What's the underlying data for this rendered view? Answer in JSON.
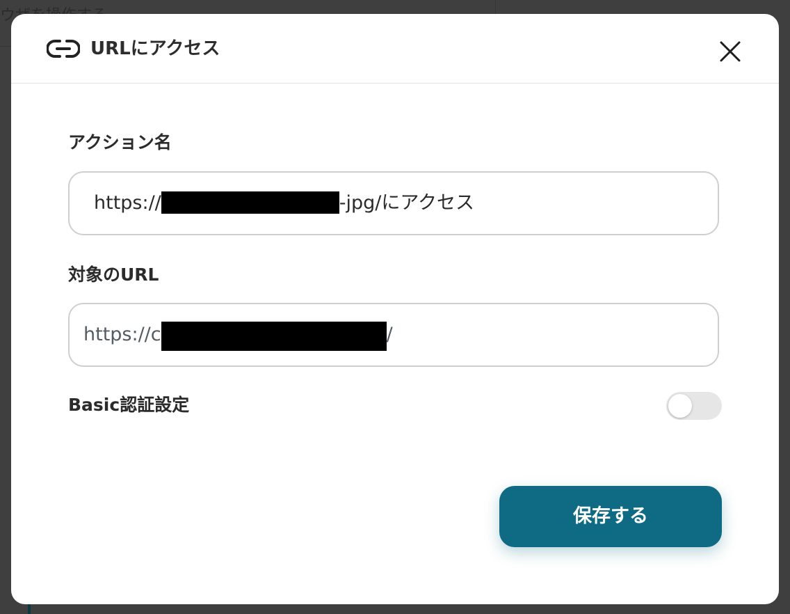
{
  "background": {
    "title": "ウザを操作する"
  },
  "dialog": {
    "title": "URLにアクセス",
    "header_icon": "link-icon",
    "close_icon": "close-icon"
  },
  "fields": {
    "action_name": {
      "label": "アクション名",
      "value_prefix": "https://",
      "value_suffix": "-jpg/にアクセス"
    },
    "target_url": {
      "label": "対象のURL",
      "value_prefix": "https://c",
      "value_suffix": "/"
    },
    "basic_auth": {
      "label": "Basic認証設定",
      "enabled": false
    }
  },
  "actions": {
    "save_label": "保存する"
  },
  "colors": {
    "accent": "#0f6b83",
    "toggle_off": "#e6e6e6",
    "field_border": "#cfcfcf"
  }
}
